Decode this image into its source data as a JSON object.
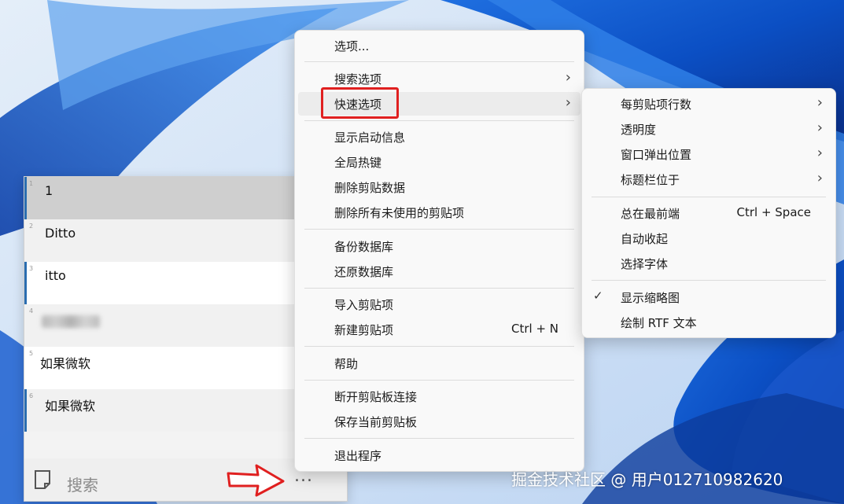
{
  "ditto": {
    "items": [
      {
        "num": "1",
        "text": "1"
      },
      {
        "num": "2",
        "text": "Ditto"
      },
      {
        "num": "3",
        "text": "itto"
      },
      {
        "num": "4",
        "text": ""
      },
      {
        "num": "5",
        "text": "如果微软"
      },
      {
        "num": "6",
        "text": "如果微软"
      }
    ],
    "search_label": "搜索",
    "more_label": "..."
  },
  "main_menu": {
    "options": "选项...",
    "search_options": "搜索选项",
    "quick_options": "快速选项",
    "show_startup_info": "显示启动信息",
    "global_hotkeys": "全局热键",
    "delete_clip_data": "删除剪贴数据",
    "delete_all_unused": "删除所有未使用的剪贴项",
    "backup_db": "备份数据库",
    "restore_db": "还原数据库",
    "import_clip": "导入剪贴项",
    "new_clip": "新建剪贴项",
    "new_clip_shortcut": "Ctrl + N",
    "help": "帮助",
    "disconnect_clipboard": "断开剪贴板连接",
    "save_current_clipboard": "保存当前剪贴板",
    "exit": "退出程序"
  },
  "sub_menu": {
    "lines_per_clip": "每剪贴项行数",
    "transparency": "透明度",
    "popup_position": "窗口弹出位置",
    "caption_bar_position": "标题栏位于",
    "always_on_top": "总在最前端",
    "always_on_top_shortcut": "Ctrl + Space",
    "auto_hide": "自动收起",
    "choose_font": "选择字体",
    "show_thumbnails": "显示缩略图",
    "draw_rtf": "绘制 RTF 文本"
  },
  "watermark": "掘金技术社区 @ 用户012710982620",
  "colors": {
    "accent_bar": "#2a6db0",
    "highlight": "#e02020"
  }
}
